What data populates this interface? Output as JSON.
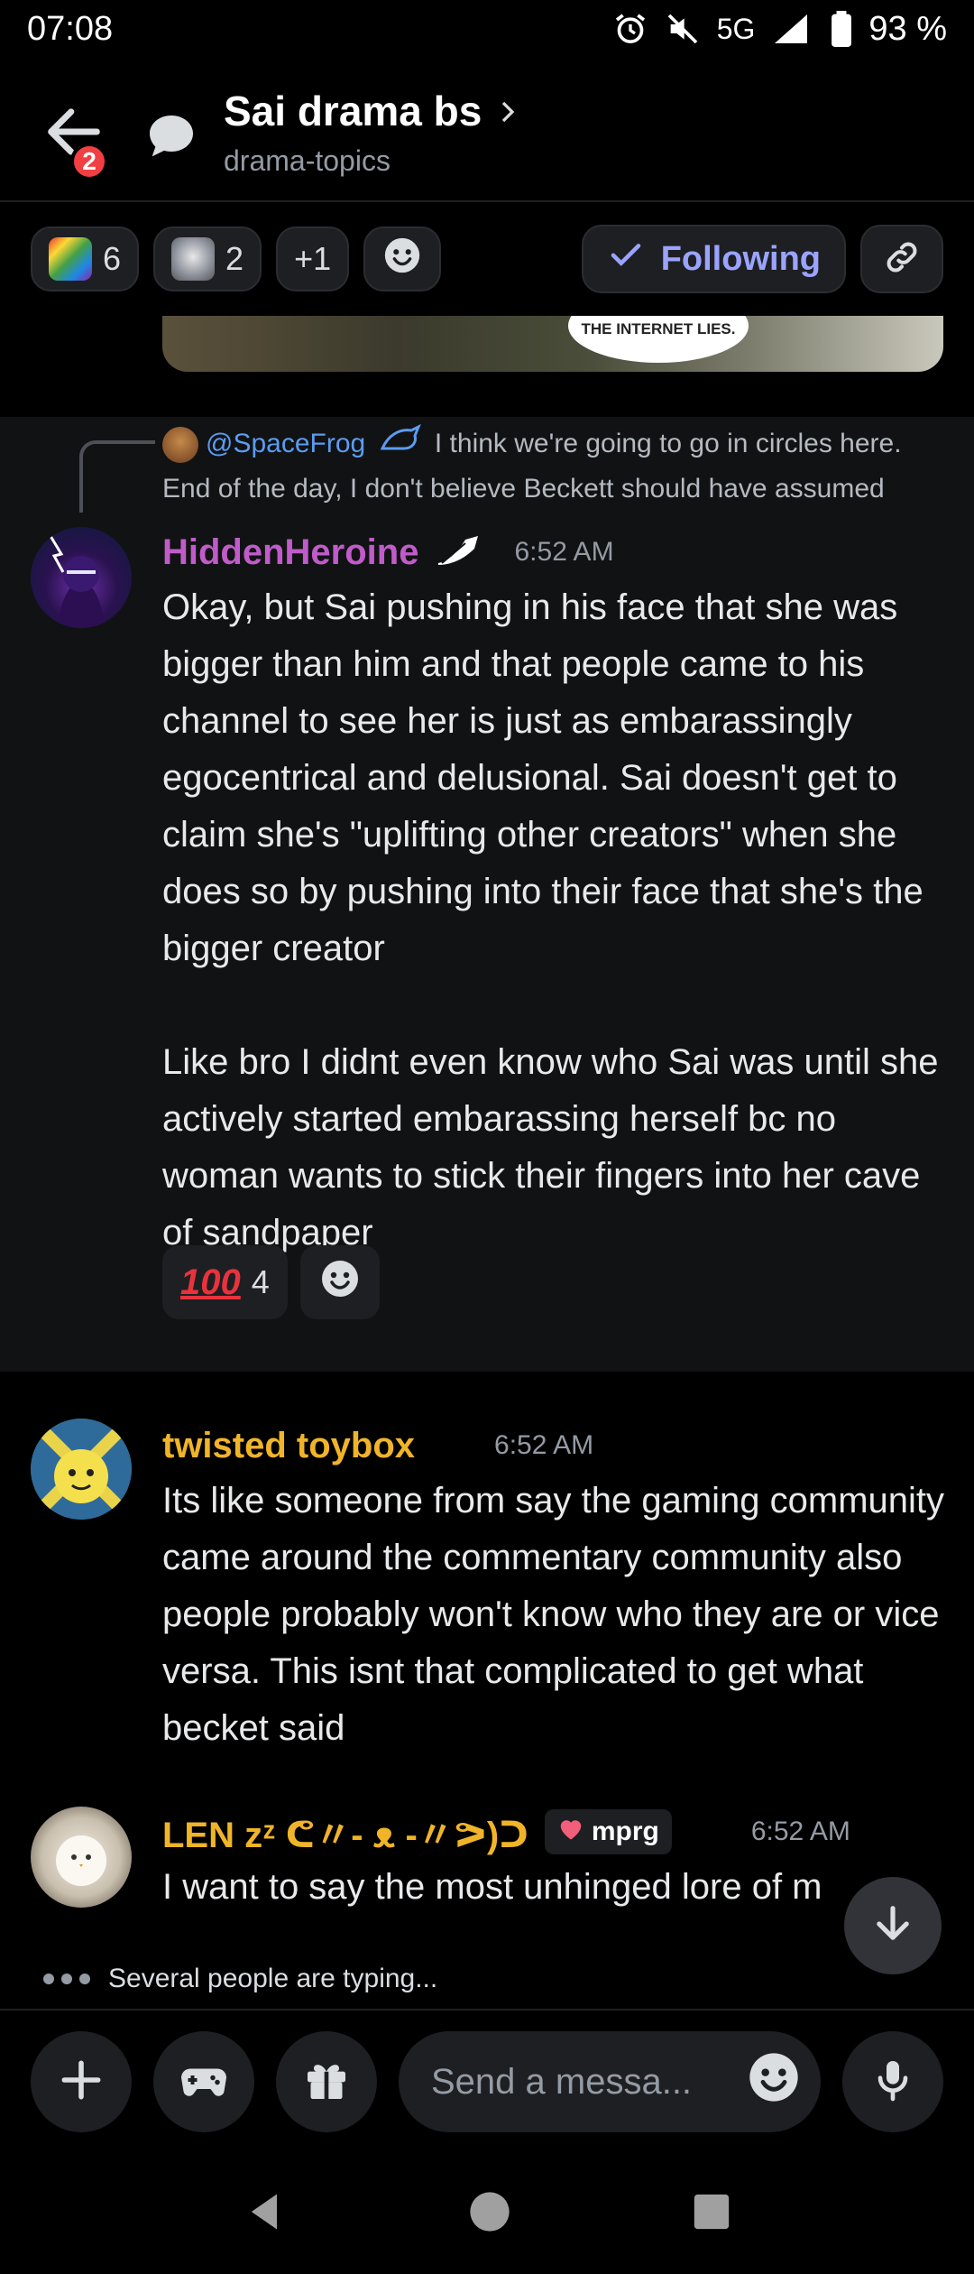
{
  "status_bar": {
    "time": "07:08",
    "network": "5G",
    "battery": "93 %",
    "icons": [
      "alarm-icon",
      "mute-icon",
      "signal-icon",
      "battery-icon"
    ]
  },
  "header": {
    "back_badge": "2",
    "thread_title": "Sai drama bs",
    "channel": "drama-topics"
  },
  "action_bar": {
    "chip_1_count": "6",
    "chip_2_count": "2",
    "chip_3_label": "+1",
    "following_label": "Following"
  },
  "image_strip": {
    "caption": "THE INTERNET LIES."
  },
  "reply_preview": {
    "mention": "@SpaceFrog",
    "text": " I think we're going to go in circles here. End of the day, I don't believe Beckett should have assumed"
  },
  "messages": [
    {
      "author": "HiddenHeroine",
      "author_color": "#c05cc9",
      "timestamp": "6:52 AM",
      "body": "Okay, but Sai pushing in his face that she was bigger than him and that people came to his channel to see her is just as embarassingly egocentrical and delusional. Sai doesn't get to claim she's \"uplifting other creators\" when she does so by pushing into their face that she's the bigger creator\n\nLike bro I didnt even know who Sai was until she actively started embarassing herself bc no woman wants to stick their fingers into her cave of sandpaper",
      "reaction_emoji": "100",
      "reaction_count": "4"
    },
    {
      "author": "twisted toybox",
      "author_color": "#f0b429",
      "timestamp": "6:52 AM",
      "body": "Its like someone from say the gaming community came around the commentary community also people probably won't know who they are or vice versa. This isnt that complicated to get what becket said"
    },
    {
      "author": "LEN zᶻ ᕦ〃- ᴥ -〃ᕗ)ᑐ",
      "author_color": "#f0b429",
      "role": "mprg",
      "timestamp": "6:52 AM",
      "body": "I want to say the most unhinged lore of m"
    }
  ],
  "typing": {
    "text": "Several people are typing..."
  },
  "composer": {
    "placeholder": "Send a messa..."
  },
  "colors": {
    "background": "#000000",
    "accent": "#9aa4ff",
    "highlight_row": "#111214",
    "badge": "#f23f43"
  }
}
